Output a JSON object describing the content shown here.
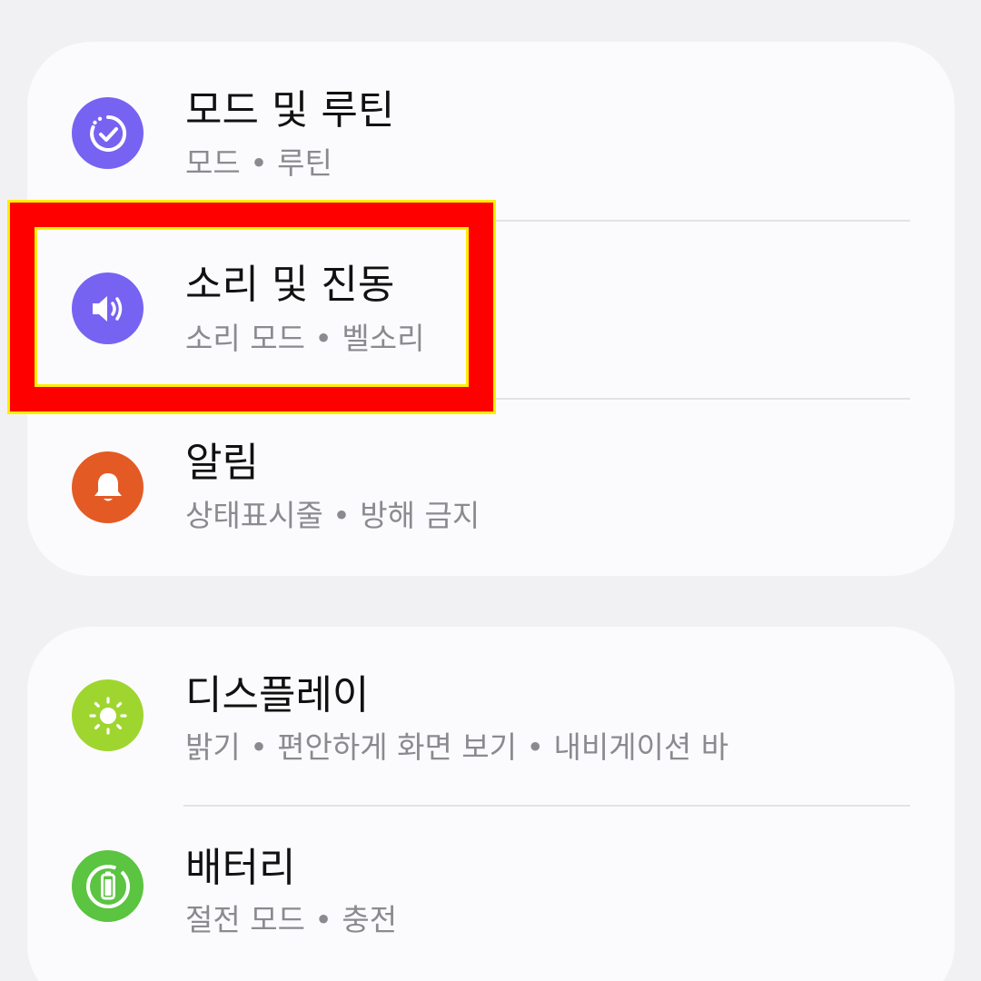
{
  "colors": {
    "background": "#f1f1f3",
    "card": "#fbfbfd",
    "highlight_border": "#ff0000",
    "highlight_outline": "#ffee00",
    "modes_icon": "#7663f2",
    "sound_icon": "#7663f2",
    "notifications_icon": "#e45a24",
    "display_icon": "#9fd52f",
    "battery_icon": "#5bc441"
  },
  "settings": {
    "modes": {
      "title": "모드 및 루틴",
      "subtitle": "모드 • 루틴",
      "icon": "modes-routines-icon"
    },
    "sound": {
      "title": "소리 및 진동",
      "subtitle": "소리 모드 • 벨소리",
      "icon": "speaker-icon"
    },
    "notifications": {
      "title": "알림",
      "subtitle": "상태표시줄 • 방해 금지",
      "icon": "bell-icon"
    },
    "display": {
      "title": "디스플레이",
      "subtitle": "밝기 • 편안하게 화면 보기 • 내비게이션 바",
      "icon": "sun-icon"
    },
    "battery": {
      "title": "배터리",
      "subtitle": "절전 모드 • 충전",
      "icon": "battery-icon"
    }
  }
}
